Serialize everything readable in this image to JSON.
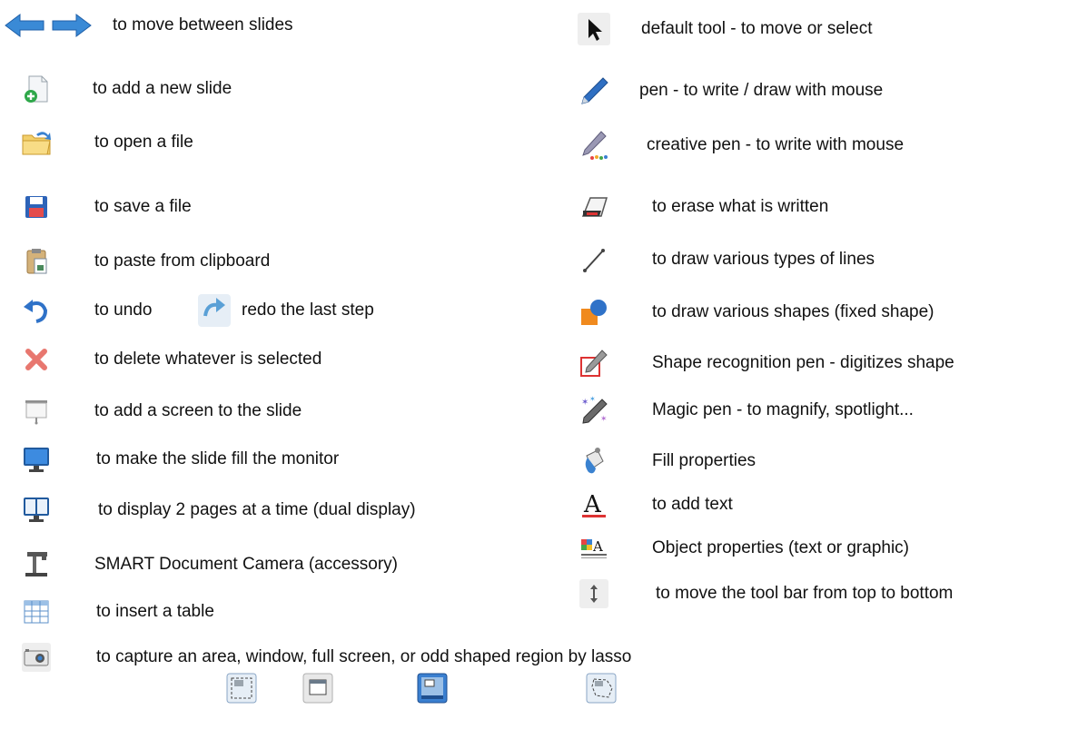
{
  "left_column": [
    {
      "icon": "arrow-left-right-icon",
      "label": "to move between slides"
    },
    {
      "icon": "add-slide-icon",
      "label": "to add a new slide"
    },
    {
      "icon": "open-folder-icon",
      "label": "to open a file"
    },
    {
      "icon": "floppy-disk-icon",
      "label": "to save a file"
    },
    {
      "icon": "paste-clipboard-icon",
      "label": "to paste from clipboard"
    },
    {
      "icon": "undo-icon",
      "label": "to undo",
      "second_icon": "redo-icon",
      "second_label": "redo the last step"
    },
    {
      "icon": "delete-x-icon",
      "label": "to delete whatever is selected"
    },
    {
      "icon": "projection-screen-icon",
      "label": "to add a screen to the slide"
    },
    {
      "icon": "monitor-icon",
      "label": "to make the slide fill the monitor"
    },
    {
      "icon": "dual-display-icon",
      "label": "to display 2 pages at a time (dual display)"
    },
    {
      "icon": "document-camera-icon",
      "label": "SMART Document Camera (accessory)"
    },
    {
      "icon": "table-icon",
      "label": "to insert a table"
    }
  ],
  "right_column": [
    {
      "icon": "cursor-arrow-icon",
      "label": "default tool - to move or select"
    },
    {
      "icon": "pen-icon",
      "label": "pen - to write / draw with mouse"
    },
    {
      "icon": "creative-pen-icon",
      "label": "creative pen - to write with mouse"
    },
    {
      "icon": "eraser-icon",
      "label": "to erase what is written"
    },
    {
      "icon": "line-tool-icon",
      "label": "to draw various types of lines"
    },
    {
      "icon": "shapes-icon",
      "label": "to draw various shapes (fixed shape)"
    },
    {
      "icon": "shape-recognition-pen-icon",
      "label": "Shape recognition pen - digitizes shape"
    },
    {
      "icon": "magic-pen-icon",
      "label": "Magic pen - to magnify, spotlight..."
    },
    {
      "icon": "fill-bucket-icon",
      "label": "Fill properties"
    },
    {
      "icon": "text-tool-icon",
      "label": "to add text"
    },
    {
      "icon": "object-properties-icon",
      "label": "Object properties (text or graphic)"
    },
    {
      "icon": "move-toolbar-icon",
      "label": "to move the tool bar from top to bottom"
    }
  ],
  "capture": {
    "icon": "camera-icon",
    "label": "to capture an area, window, full screen, or odd shaped region by lasso",
    "sub_icons": [
      "capture-area-icon",
      "capture-window-icon",
      "capture-fullscreen-icon",
      "capture-freehand-icon"
    ]
  }
}
